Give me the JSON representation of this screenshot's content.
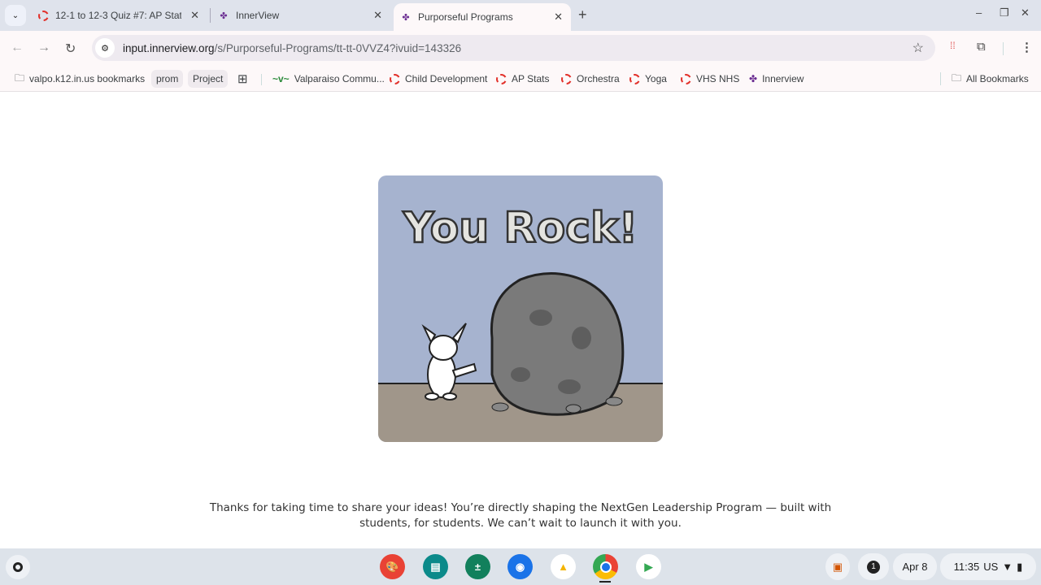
{
  "tabs": [
    {
      "title": "12-1 to 12-3 Quiz #7: AP Statis",
      "icon": "canvas-ring-icon"
    },
    {
      "title": "InnerView",
      "icon": "innerview-icon"
    },
    {
      "title": "Purporseful Programs",
      "icon": "innerview-icon",
      "active": true
    }
  ],
  "address_bar": {
    "host": "input.innerview.org",
    "path": "/s/Purporseful-Programs/tt-tt-0VVZ4?ivuid=143326"
  },
  "bookmarks": [
    {
      "label": "valpo.k12.in.us bookmarks",
      "icon": "managed-folder-icon"
    },
    {
      "label": "prom",
      "icon": "chip"
    },
    {
      "label": "Project",
      "icon": "chip"
    },
    {
      "label": "Valparaiso Commu...",
      "icon": "valpo-icon"
    },
    {
      "label": "Child Development",
      "icon": "canvas-ring-icon"
    },
    {
      "label": "AP Stats",
      "icon": "canvas-ring-icon"
    },
    {
      "label": "Orchestra",
      "icon": "canvas-ring-icon"
    },
    {
      "label": "Yoga",
      "icon": "canvas-ring-icon"
    },
    {
      "label": "VHS NHS",
      "icon": "canvas-ring-icon"
    },
    {
      "label": "Innerview",
      "icon": "innerview-icon"
    }
  ],
  "all_bookmarks": "All Bookmarks",
  "hero": {
    "caption": "You Rock!"
  },
  "message": {
    "line1": "Thanks for taking  time to share your ideas! You’re directly shaping the NextGen Leadership Program — built with",
    "line2": "students, for students. We can’t wait to launch it with you."
  },
  "shelf": {
    "notifications": "1",
    "date": "Apr 8",
    "time": "11:35",
    "locale": "US"
  }
}
